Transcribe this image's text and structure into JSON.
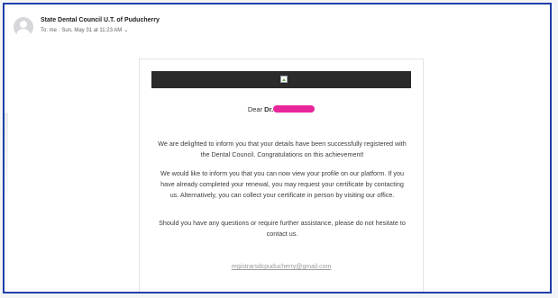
{
  "email": {
    "sender": "State Dental Council U.T. of Puducherry",
    "meta": "To: me · Sun, May 31 at 11:23 AM",
    "greeting_prefix": "Dear ",
    "greeting_dr": "Dr.",
    "paragraph1": "We are delighted to inform you that your details have been successfully registered with the Dental Council. Congratulations on this achievement!",
    "paragraph2": "We would like to inform you that you can now view your profile on our platform. If you have already completed your renewal, you may request your certificate by contacting us. Alternatively, you can collect your certificate in person by visiting our office.",
    "paragraph3": "Should you have any questions or require further assistance, please do not hesitate to contact us.",
    "contact_email": "registrarsdcpuducherry@gmail.com"
  },
  "icons": {
    "avatar": "user-avatar-icon",
    "chevron": "chevron-down-icon",
    "broken_image": "broken-image-icon"
  },
  "colors": {
    "frame_border": "#1f3fa8",
    "banner": "#2b2b2b",
    "redaction": "#e8259a"
  }
}
